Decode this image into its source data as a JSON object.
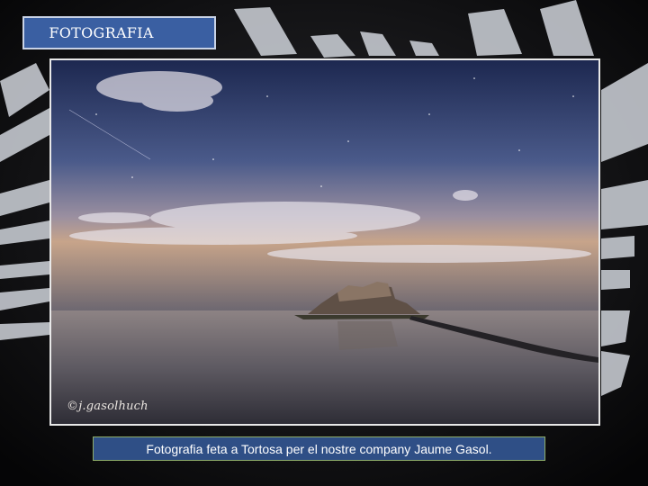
{
  "slide": {
    "title": "FOTOGRAFIA",
    "caption": "Fotografia feta a Tortosa per el nostre company Jaume Gasol.",
    "photo_watermark": "©j.gasolhuch"
  },
  "colors": {
    "title_box": "#3a5fa2",
    "caption_box": "#2f4f86",
    "background": "#0b0b0d"
  }
}
